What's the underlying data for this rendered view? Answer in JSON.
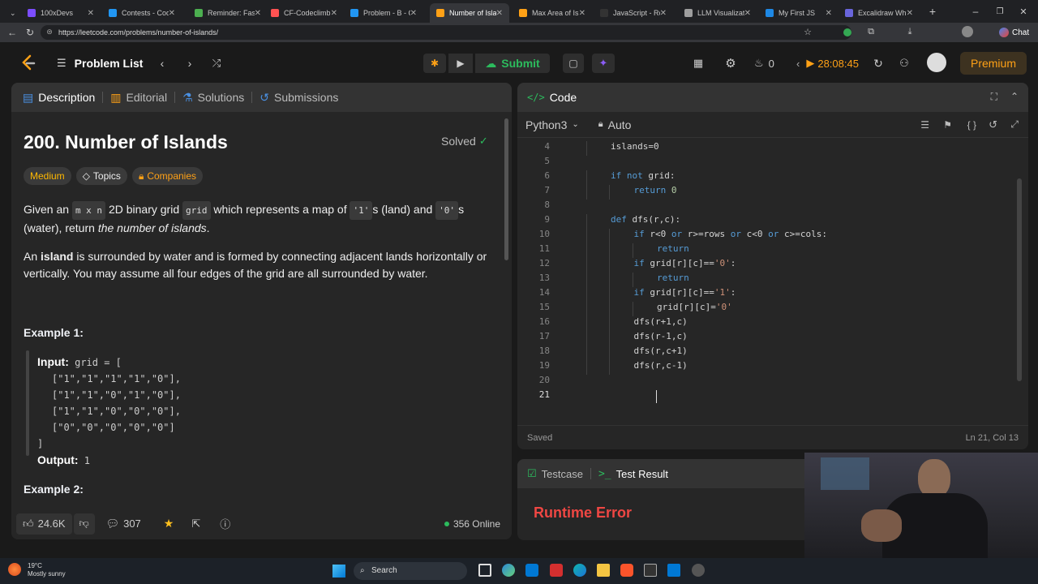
{
  "browser": {
    "tabs": [
      "100xDevs",
      "Contests - Codefo",
      "Reminder: Fast-tr",
      "CF-Codeclimb",
      "Problem - B - Co",
      "Number of Islands",
      "Max Area of Islan",
      "JavaScript - Road",
      "LLM Visualization",
      "My First JS",
      "Excalidraw White"
    ],
    "url": "https://leetcode.com/problems/number-of-islands/",
    "chat_label": "Chat"
  },
  "nav": {
    "problem_list": "Problem List",
    "submit": "Submit",
    "fire_count": "0",
    "timer": "28:08:45",
    "premium": "Premium"
  },
  "left": {
    "tabs": [
      "Description",
      "Editorial",
      "Solutions",
      "Submissions"
    ],
    "title": "200. Number of Islands",
    "solved": "Solved",
    "tags": [
      "Medium",
      "Topics",
      "Companies"
    ],
    "desc1_pre": "Given an",
    "desc1_code1": "m x n",
    "desc1_mid1": "2D binary grid",
    "desc1_code2": "grid",
    "desc1_mid2": "which represents a map of",
    "desc1_code3": "'1'",
    "desc1_mid3": "s (land) and",
    "desc1_code4": "'0'",
    "desc1_end": "s",
    "desc1_line2": "(water), return",
    "desc1_em": "the number of islands",
    "desc2_pre": "An",
    "desc2_bold": "island",
    "desc2_rest": "is surrounded by water and is formed by connecting adjacent lands horizontally or",
    "desc2_line2": "vertically. You may assume all four edges of the grid are all surrounded by water.",
    "example1": "Example 1:",
    "input_label": "Input:",
    "input_first": "grid = [",
    "input_rows": [
      "[\"1\",\"1\",\"1\",\"1\",\"0\"],",
      "[\"1\",\"1\",\"0\",\"1\",\"0\"],",
      "[\"1\",\"1\",\"0\",\"0\",\"0\"],",
      "[\"0\",\"0\",\"0\",\"0\",\"0\"]"
    ],
    "input_close": "]",
    "output_label": "Output:",
    "output_value": "1",
    "example2": "Example 2:",
    "likes": "24.6K",
    "comments": "307",
    "online": "356 Online"
  },
  "code": {
    "header": "Code",
    "language": "Python3",
    "auto": "Auto",
    "saved": "Saved",
    "cursor": "Ln 21, Col 13",
    "lines": [
      {
        "n": "4",
        "indent": 2,
        "segs": [
          [
            "islands=0",
            ""
          ]
        ]
      },
      {
        "n": "5",
        "indent": 0,
        "segs": []
      },
      {
        "n": "6",
        "indent": 2,
        "segs": [
          [
            "if not ",
            "kw"
          ],
          [
            "grid:",
            ""
          ]
        ]
      },
      {
        "n": "7",
        "indent": 3,
        "segs": [
          [
            "return ",
            "kw"
          ],
          [
            "0",
            "nm"
          ]
        ]
      },
      {
        "n": "8",
        "indent": 0,
        "segs": []
      },
      {
        "n": "9",
        "indent": 2,
        "segs": [
          [
            "def ",
            "kw"
          ],
          [
            "dfs(r,c):",
            ""
          ]
        ]
      },
      {
        "n": "10",
        "indent": 3,
        "segs": [
          [
            "if ",
            "kw"
          ],
          [
            "r<0 ",
            ""
          ],
          [
            "or ",
            "kw"
          ],
          [
            "r>=rows ",
            ""
          ],
          [
            "or ",
            "kw"
          ],
          [
            "c<0 ",
            ""
          ],
          [
            "or ",
            "kw"
          ],
          [
            "c>=cols:",
            ""
          ]
        ]
      },
      {
        "n": "11",
        "indent": 4,
        "segs": [
          [
            "return",
            "kw"
          ]
        ]
      },
      {
        "n": "12",
        "indent": 3,
        "segs": [
          [
            "if ",
            "kw"
          ],
          [
            "grid[r][c]==",
            ""
          ],
          [
            "'0'",
            "st"
          ],
          [
            ":",
            ""
          ]
        ]
      },
      {
        "n": "13",
        "indent": 4,
        "segs": [
          [
            "return",
            "kw"
          ]
        ]
      },
      {
        "n": "14",
        "indent": 3,
        "segs": [
          [
            "if ",
            "kw"
          ],
          [
            "grid[r][c]==",
            ""
          ],
          [
            "'1'",
            "st"
          ],
          [
            ":",
            ""
          ]
        ]
      },
      {
        "n": "15",
        "indent": 4,
        "segs": [
          [
            "grid[r][c]=",
            ""
          ],
          [
            "'0'",
            "st"
          ]
        ]
      },
      {
        "n": "16",
        "indent": 3,
        "segs": [
          [
            "dfs(r+1,c)",
            ""
          ]
        ]
      },
      {
        "n": "17",
        "indent": 3,
        "segs": [
          [
            "dfs(r-1,c)",
            ""
          ]
        ]
      },
      {
        "n": "18",
        "indent": 3,
        "segs": [
          [
            "dfs(r,c+1)",
            ""
          ]
        ]
      },
      {
        "n": "19",
        "indent": 3,
        "segs": [
          [
            "dfs(r,c-1)",
            ""
          ]
        ]
      },
      {
        "n": "20",
        "indent": 0,
        "segs": []
      },
      {
        "n": "21",
        "indent": 0,
        "segs": []
      }
    ]
  },
  "bottom": {
    "testcase": "Testcase",
    "test_result": "Test Result",
    "error": "Runtime Error"
  },
  "taskbar": {
    "temp": "19°C",
    "weather": "Mostly sunny",
    "search": "Search"
  }
}
